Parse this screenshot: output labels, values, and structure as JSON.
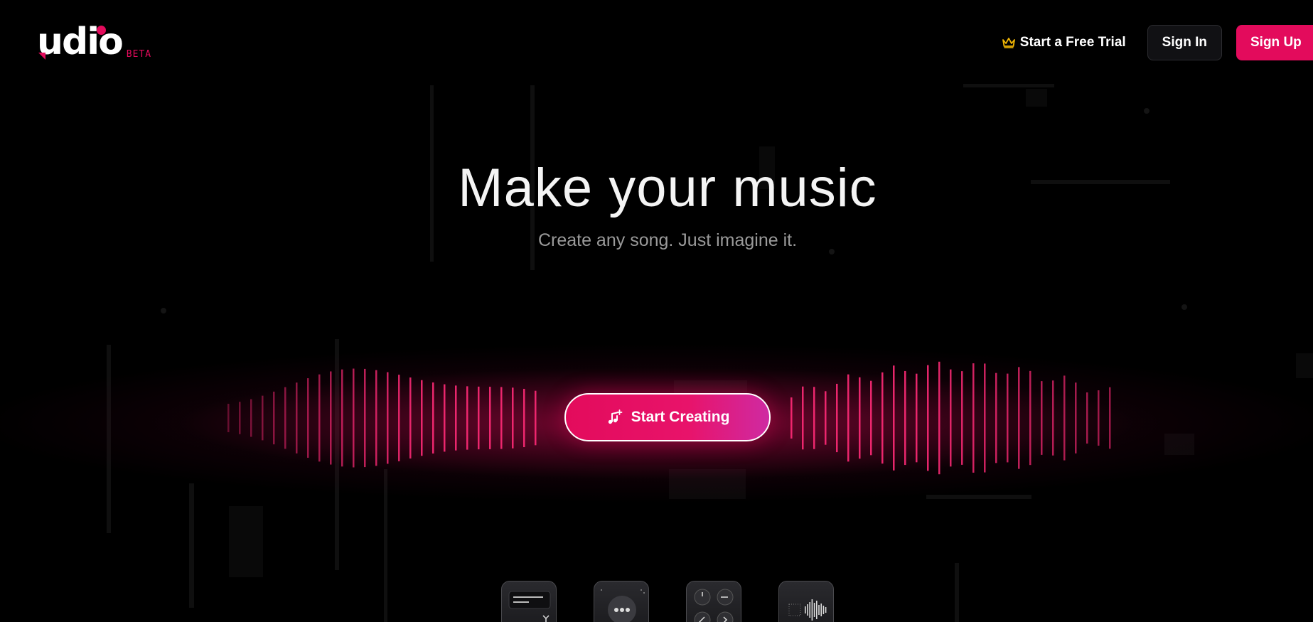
{
  "brand": {
    "name": "udio",
    "badge": "BETA",
    "accent_color": "#e30b5c"
  },
  "nav": {
    "trial_label": "Start a Free Trial",
    "trial_icon": "crown-icon",
    "signin_label": "Sign In",
    "signup_label": "Sign Up"
  },
  "hero": {
    "title": "Make your music",
    "subtitle": "Create any song. Just imagine it.",
    "cta_label": "Start Creating",
    "cta_icon": "music-note-plus-icon"
  },
  "feature_tiles": [
    {
      "icon": "text-prompt-icon"
    },
    {
      "icon": "more-options-icon"
    },
    {
      "icon": "knobs-icon"
    },
    {
      "icon": "waveform-icon"
    }
  ]
}
